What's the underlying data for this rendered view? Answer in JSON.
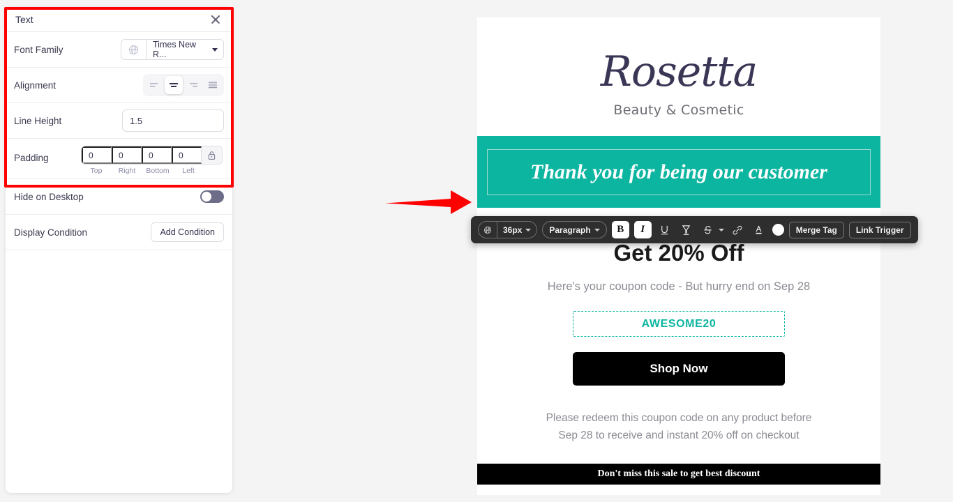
{
  "settings_panel": {
    "title": "Text",
    "close_icon": "close-icon",
    "rows": {
      "font_family": {
        "label": "Font Family",
        "icon": "globe-translate-icon",
        "value": "Times New R...",
        "chevron_icon": "chevron-down-icon"
      },
      "alignment": {
        "label": "Alignment",
        "options": [
          {
            "name": "align-left",
            "icon": "align-left-icon",
            "selected": false
          },
          {
            "name": "align-center",
            "icon": "align-center-icon",
            "selected": true
          },
          {
            "name": "align-right",
            "icon": "align-right-icon",
            "selected": false
          },
          {
            "name": "align-justify",
            "icon": "align-justify-icon",
            "selected": false
          }
        ]
      },
      "line_height": {
        "label": "Line Height",
        "value": "1.5",
        "placeholder": "1.5"
      },
      "padding": {
        "label": "Padding",
        "values": [
          "0",
          "0",
          "0",
          "0"
        ],
        "sub_labels": [
          "Top",
          "Right",
          "Bottom",
          "Left"
        ],
        "lock_icon": "lock-icon"
      },
      "hide_on_desktop": {
        "label": "Hide on Desktop",
        "enabled": false
      },
      "display_condition": {
        "label": "Display Condition",
        "button": "Add Condition"
      }
    }
  },
  "annotation": {
    "highlight_color": "#ff0000",
    "arrow_color": "#ff0000",
    "arrow_icon": "arrow-right-icon"
  },
  "email_preview": {
    "logo": {
      "name": "Rosetta",
      "tagline": "Beauty & Cosmetic"
    },
    "banner": {
      "text": "Thank you for being our customer",
      "background_color": "#0cb5a0",
      "selected": true
    },
    "headline": "Get 20% Off",
    "subline": "Here's your coupon code - But hurry end on Sep 28",
    "coupon_code": "AWESOME20",
    "coupon_border_color": "#0cb5a0",
    "cta_button": "Shop Now",
    "legal_lines": [
      "Please redeem this coupon code on any product before",
      "Sep 28 to receive and instant 20% off on checkout"
    ],
    "footer": "Don't miss this sale to get best discount"
  },
  "rte_toolbar": {
    "font_size": {
      "value": "36px",
      "icon": "globe-translate-icon",
      "chevron_icon": "chevron-down-icon"
    },
    "block_format": {
      "value": "Paragraph",
      "chevron_icon": "chevron-down-icon"
    },
    "bold": {
      "label": "B",
      "icon": "bold-icon",
      "active": true
    },
    "italic": {
      "label": "I",
      "icon": "italic-icon",
      "active": true
    },
    "underline": {
      "icon": "underline-icon",
      "active": false
    },
    "highlight": {
      "icon": "highlighter-icon",
      "active": false
    },
    "strikethrough": {
      "icon": "strikethrough-icon",
      "chevron_icon": "chevron-down-icon",
      "active": false
    },
    "link": {
      "icon": "link-icon"
    },
    "font_color": {
      "icon": "font-color-icon",
      "swatch_color": "#ffffff"
    },
    "merge_tag_button": "Merge Tag",
    "link_trigger_button": "Link Trigger"
  }
}
